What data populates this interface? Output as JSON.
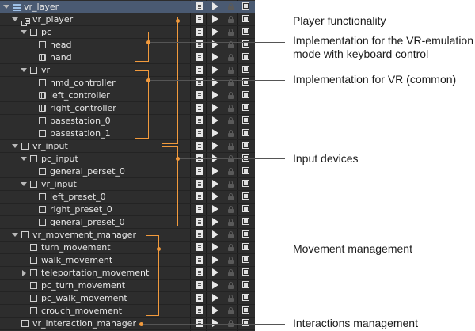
{
  "outliner": {
    "rows": [
      {
        "label": "vr_layer",
        "icon": "layer-icon",
        "expanded": true,
        "selected": true
      },
      {
        "label": "vr_player",
        "icon": "node-group-icon",
        "expanded": true
      },
      {
        "label": "pc",
        "icon": "dummy-node-icon",
        "expanded": true
      },
      {
        "label": "head",
        "icon": "dummy-node-icon"
      },
      {
        "label": "hand",
        "icon": "mesh-icon"
      },
      {
        "label": "vr",
        "icon": "dummy-node-icon",
        "expanded": true
      },
      {
        "label": "hmd_controller",
        "icon": "dummy-node-icon"
      },
      {
        "label": "left_controller",
        "icon": "mesh-icon"
      },
      {
        "label": "right_controller",
        "icon": "mesh-icon"
      },
      {
        "label": "basestation_0",
        "icon": "dummy-node-icon"
      },
      {
        "label": "basestation_1",
        "icon": "dummy-node-icon"
      },
      {
        "label": "vr_input",
        "icon": "dummy-node-icon",
        "expanded": true
      },
      {
        "label": "pc_input",
        "icon": "dummy-node-icon",
        "expanded": true
      },
      {
        "label": "general_perset_0",
        "icon": "dummy-node-icon"
      },
      {
        "label": "vr_input",
        "icon": "dummy-node-icon",
        "expanded": true
      },
      {
        "label": "left_preset_0",
        "icon": "dummy-node-icon"
      },
      {
        "label": "right_preset_0",
        "icon": "dummy-node-icon"
      },
      {
        "label": "general_preset_0",
        "icon": "dummy-node-icon"
      },
      {
        "label": "vr_movement_manager",
        "icon": "dummy-node-icon",
        "expanded": true
      },
      {
        "label": "turn_movement",
        "icon": "dummy-node-icon"
      },
      {
        "label": "walk_movement",
        "icon": "dummy-node-icon"
      },
      {
        "label": "teleportation_movement",
        "icon": "dummy-node-icon",
        "collapsed": true
      },
      {
        "label": "pc_turn_movement",
        "icon": "dummy-node-icon"
      },
      {
        "label": "pc_walk_movement",
        "icon": "dummy-node-icon"
      },
      {
        "label": "crouch_movement",
        "icon": "dummy-node-icon"
      },
      {
        "label": "vr_interaction_manager",
        "icon": "dummy-node-icon"
      }
    ],
    "column_icons": [
      "properties-icon",
      "enabled-play-icon",
      "lock-icon",
      "visibility-icon"
    ]
  },
  "callouts": [
    {
      "text": "Player functionality"
    },
    {
      "text": "Implementation for the VR-emulation\nmode with keyboard control"
    },
    {
      "text": "Implementation for  VR (common)"
    },
    {
      "text": "Input devices"
    },
    {
      "text": "Movement management"
    },
    {
      "text": "Interactions management"
    }
  ],
  "colors": {
    "panel_bg": "#2d2d2d",
    "selected_row": "#4a5a72",
    "annotation": "#f29a3c",
    "text": "#e6e6e6"
  }
}
